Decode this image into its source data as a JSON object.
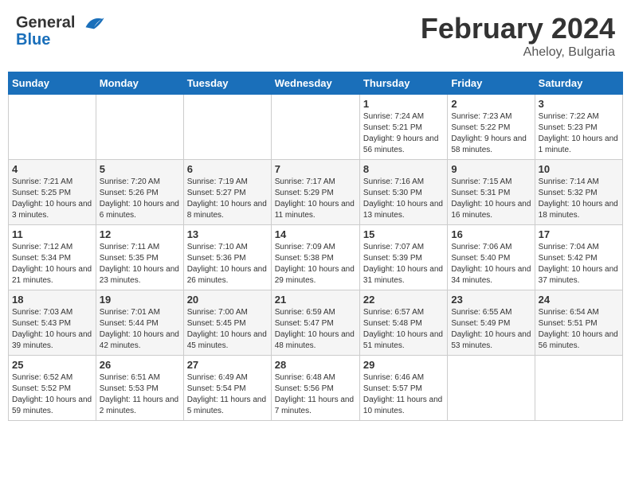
{
  "header": {
    "logo_general": "General",
    "logo_blue": "Blue",
    "month_title": "February 2024",
    "location": "Aheloy, Bulgaria"
  },
  "weekdays": [
    "Sunday",
    "Monday",
    "Tuesday",
    "Wednesday",
    "Thursday",
    "Friday",
    "Saturday"
  ],
  "weeks": [
    [
      {
        "day": "",
        "info": ""
      },
      {
        "day": "",
        "info": ""
      },
      {
        "day": "",
        "info": ""
      },
      {
        "day": "",
        "info": ""
      },
      {
        "day": "1",
        "info": "Sunrise: 7:24 AM\nSunset: 5:21 PM\nDaylight: 9 hours and 56 minutes."
      },
      {
        "day": "2",
        "info": "Sunrise: 7:23 AM\nSunset: 5:22 PM\nDaylight: 9 hours and 58 minutes."
      },
      {
        "day": "3",
        "info": "Sunrise: 7:22 AM\nSunset: 5:23 PM\nDaylight: 10 hours and 1 minute."
      }
    ],
    [
      {
        "day": "4",
        "info": "Sunrise: 7:21 AM\nSunset: 5:25 PM\nDaylight: 10 hours and 3 minutes."
      },
      {
        "day": "5",
        "info": "Sunrise: 7:20 AM\nSunset: 5:26 PM\nDaylight: 10 hours and 6 minutes."
      },
      {
        "day": "6",
        "info": "Sunrise: 7:19 AM\nSunset: 5:27 PM\nDaylight: 10 hours and 8 minutes."
      },
      {
        "day": "7",
        "info": "Sunrise: 7:17 AM\nSunset: 5:29 PM\nDaylight: 10 hours and 11 minutes."
      },
      {
        "day": "8",
        "info": "Sunrise: 7:16 AM\nSunset: 5:30 PM\nDaylight: 10 hours and 13 minutes."
      },
      {
        "day": "9",
        "info": "Sunrise: 7:15 AM\nSunset: 5:31 PM\nDaylight: 10 hours and 16 minutes."
      },
      {
        "day": "10",
        "info": "Sunrise: 7:14 AM\nSunset: 5:32 PM\nDaylight: 10 hours and 18 minutes."
      }
    ],
    [
      {
        "day": "11",
        "info": "Sunrise: 7:12 AM\nSunset: 5:34 PM\nDaylight: 10 hours and 21 minutes."
      },
      {
        "day": "12",
        "info": "Sunrise: 7:11 AM\nSunset: 5:35 PM\nDaylight: 10 hours and 23 minutes."
      },
      {
        "day": "13",
        "info": "Sunrise: 7:10 AM\nSunset: 5:36 PM\nDaylight: 10 hours and 26 minutes."
      },
      {
        "day": "14",
        "info": "Sunrise: 7:09 AM\nSunset: 5:38 PM\nDaylight: 10 hours and 29 minutes."
      },
      {
        "day": "15",
        "info": "Sunrise: 7:07 AM\nSunset: 5:39 PM\nDaylight: 10 hours and 31 minutes."
      },
      {
        "day": "16",
        "info": "Sunrise: 7:06 AM\nSunset: 5:40 PM\nDaylight: 10 hours and 34 minutes."
      },
      {
        "day": "17",
        "info": "Sunrise: 7:04 AM\nSunset: 5:42 PM\nDaylight: 10 hours and 37 minutes."
      }
    ],
    [
      {
        "day": "18",
        "info": "Sunrise: 7:03 AM\nSunset: 5:43 PM\nDaylight: 10 hours and 39 minutes."
      },
      {
        "day": "19",
        "info": "Sunrise: 7:01 AM\nSunset: 5:44 PM\nDaylight: 10 hours and 42 minutes."
      },
      {
        "day": "20",
        "info": "Sunrise: 7:00 AM\nSunset: 5:45 PM\nDaylight: 10 hours and 45 minutes."
      },
      {
        "day": "21",
        "info": "Sunrise: 6:59 AM\nSunset: 5:47 PM\nDaylight: 10 hours and 48 minutes."
      },
      {
        "day": "22",
        "info": "Sunrise: 6:57 AM\nSunset: 5:48 PM\nDaylight: 10 hours and 51 minutes."
      },
      {
        "day": "23",
        "info": "Sunrise: 6:55 AM\nSunset: 5:49 PM\nDaylight: 10 hours and 53 minutes."
      },
      {
        "day": "24",
        "info": "Sunrise: 6:54 AM\nSunset: 5:51 PM\nDaylight: 10 hours and 56 minutes."
      }
    ],
    [
      {
        "day": "25",
        "info": "Sunrise: 6:52 AM\nSunset: 5:52 PM\nDaylight: 10 hours and 59 minutes."
      },
      {
        "day": "26",
        "info": "Sunrise: 6:51 AM\nSunset: 5:53 PM\nDaylight: 11 hours and 2 minutes."
      },
      {
        "day": "27",
        "info": "Sunrise: 6:49 AM\nSunset: 5:54 PM\nDaylight: 11 hours and 5 minutes."
      },
      {
        "day": "28",
        "info": "Sunrise: 6:48 AM\nSunset: 5:56 PM\nDaylight: 11 hours and 7 minutes."
      },
      {
        "day": "29",
        "info": "Sunrise: 6:46 AM\nSunset: 5:57 PM\nDaylight: 11 hours and 10 minutes."
      },
      {
        "day": "",
        "info": ""
      },
      {
        "day": "",
        "info": ""
      }
    ]
  ]
}
